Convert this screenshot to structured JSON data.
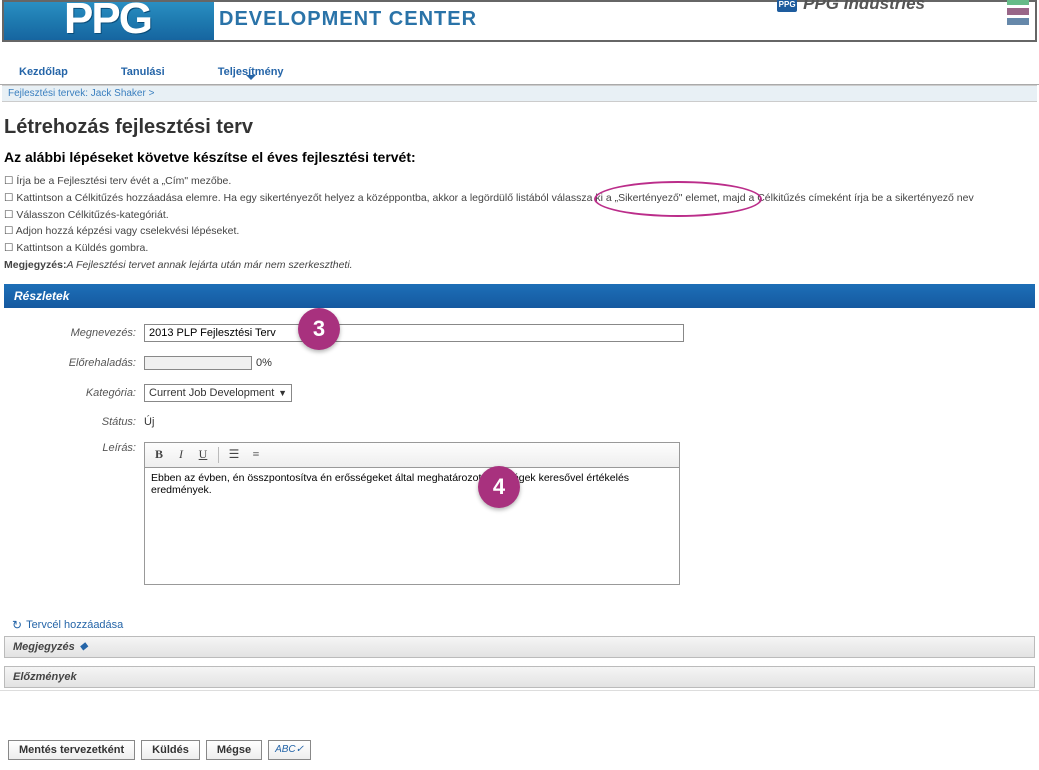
{
  "banner": {
    "logo_text": "PPG",
    "center_text": "DEVELOPMENT CENTER",
    "right_logo": "PPG",
    "right_text": "PPG Industries"
  },
  "nav": {
    "tabs": [
      "Kezdőlap",
      "Tanulási",
      "Teljesítmény"
    ],
    "active_index": 2
  },
  "breadcrumb": {
    "link": "Fejlesztési tervek: Jack Shaker",
    "sep": ">"
  },
  "page": {
    "title": "Létrehozás fejlesztési terv",
    "subtitle": "Az alábbi lépéseket követve készítse el éves fejlesztési tervét:"
  },
  "instructions": {
    "items": [
      "Írja be a Fejlesztési terv évét a „Cím\" mezőbe.",
      "Kattintson a Célkitűzés hozzáadása elemre. Ha egy sikertényezőt helyez a középpontba, akkor a legördülő listából válassza ki a „Sikertényező\" elemet, majd a Célkitűzés címeként írja be a sikertényező nev",
      "Válasszon Célkitűzés-kategóriát.",
      "Adjon hozzá képzési vagy cselekvési lépéseket.",
      "Kattintson a Küldés gombra."
    ],
    "note_label": "Megjegyzés:",
    "note_text": "A Fejlesztési tervet annak lejárta után már nem szerkesztheti."
  },
  "section": {
    "details_title": "Részletek"
  },
  "form": {
    "labels": {
      "name": "Megnevezés:",
      "progress": "Előrehaladás:",
      "category": "Kategória:",
      "status": "Státus:",
      "description": "Leírás:"
    },
    "name_value": "2013 PLP Fejlesztési Terv",
    "progress_text": "0%",
    "category_value": "Current Job Development",
    "status_value": "Új",
    "description_value": "Ebben az évben, én összpontosítva én erősségeket által meghatározott erősségek keresővel értékelés eredmények."
  },
  "badges": {
    "b3": "3",
    "b4": "4"
  },
  "links": {
    "add_goal": "Tervcél hozzáadása"
  },
  "collapsibles": {
    "notes": "Megjegyzés",
    "history": "Előzmények"
  },
  "buttons": {
    "save_draft": "Mentés tervezetként",
    "submit": "Küldés",
    "cancel": "Mégse",
    "spell": "ABC✓"
  }
}
